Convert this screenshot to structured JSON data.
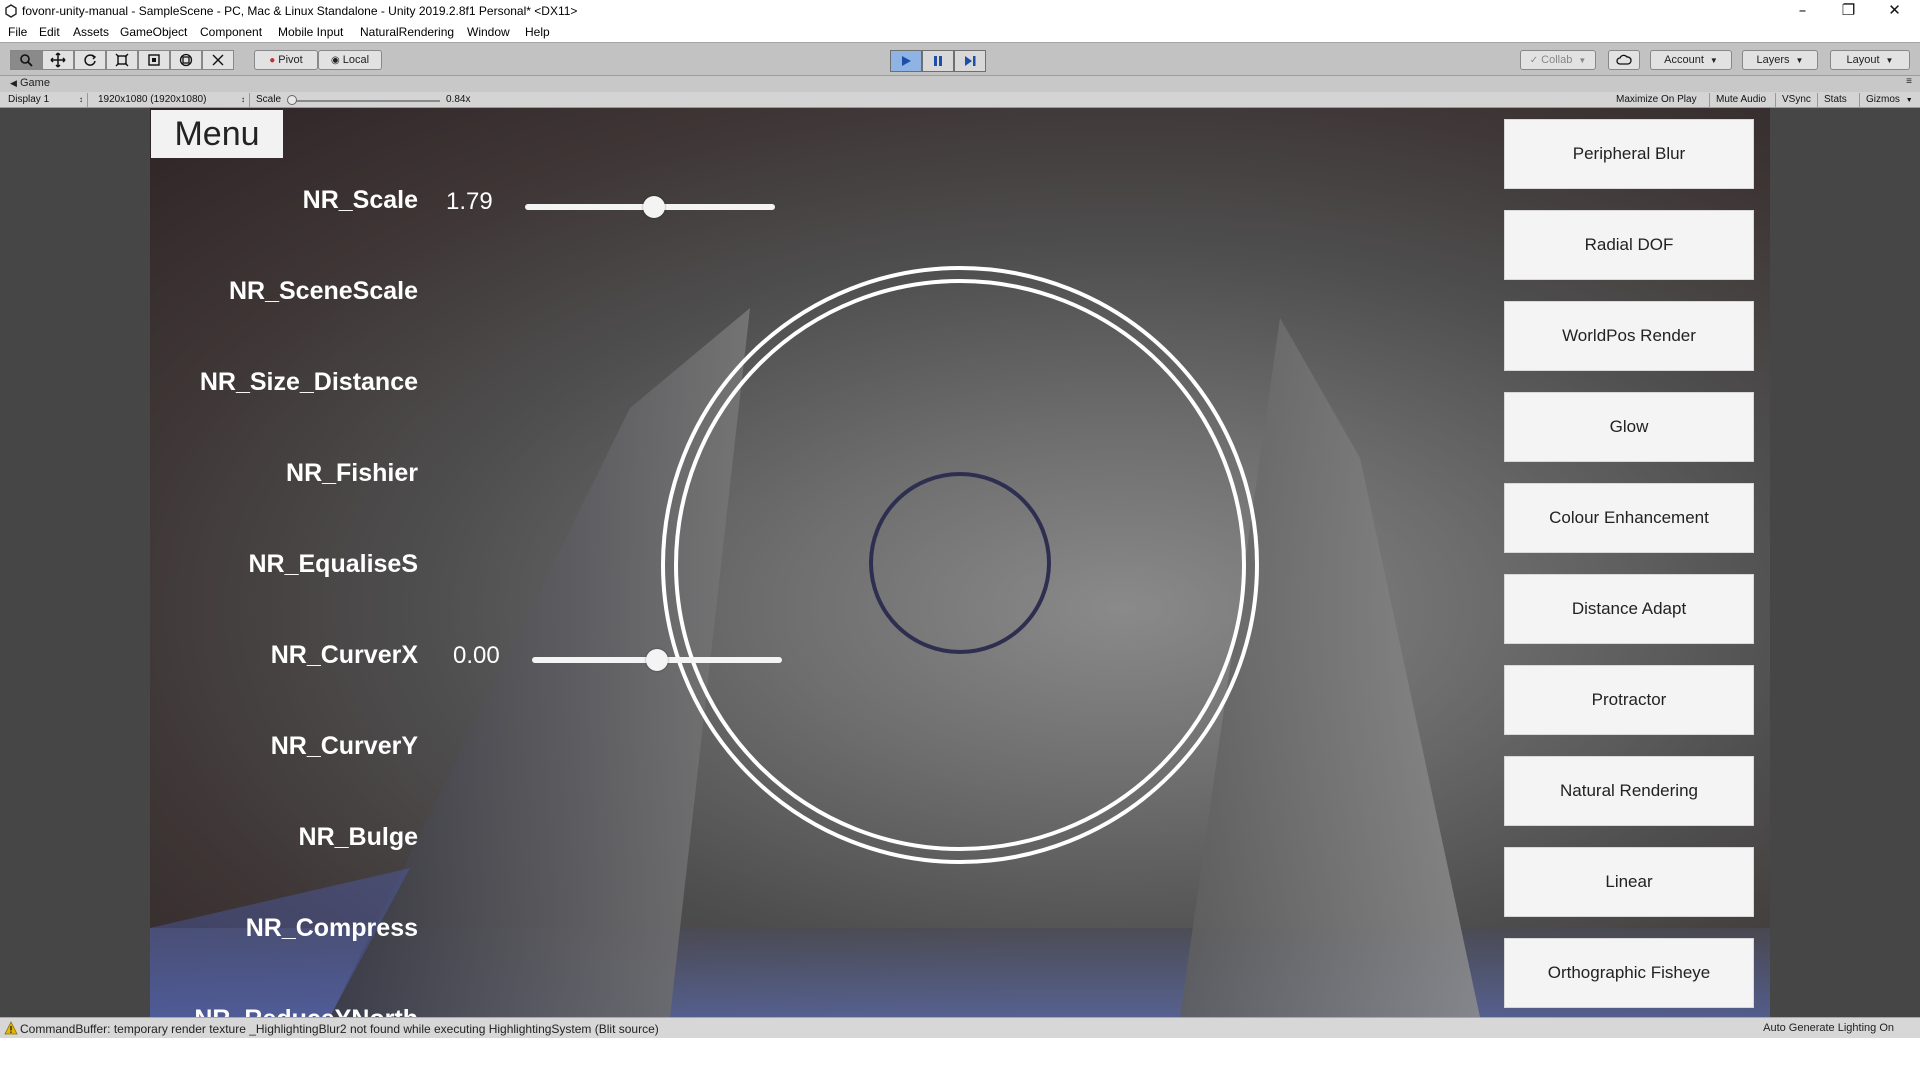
{
  "window": {
    "title": "fovonr-unity-manual - SampleScene - PC, Mac & Linux Standalone - Unity 2019.2.8f1 Personal* <DX11>",
    "minimize_icon": "minimize-icon",
    "restore_icon": "restore-icon",
    "close_icon": "close-icon"
  },
  "menubar": {
    "items": [
      "File",
      "Edit",
      "Assets",
      "GameObject",
      "Component",
      "Mobile Input",
      "NaturalRendering",
      "Window",
      "Help"
    ]
  },
  "toolbar": {
    "tools": [
      "hand-tool-icon",
      "move-tool-icon",
      "rotate-tool-icon",
      "scale-tool-icon",
      "rect-tool-icon",
      "transform-tool-icon",
      "custom-tool-icon"
    ],
    "pivot_label": "Pivot",
    "local_label": "Local",
    "collab_label": "Collab",
    "account_label": "Account",
    "layers_label": "Layers",
    "layout_label": "Layout",
    "play_state": "playing",
    "accent_color": "#8fb3e3"
  },
  "game_tab": {
    "label": "Game"
  },
  "game_controls": {
    "display": "Display 1",
    "resolution": "1920x1080 (1920x1080)",
    "scale_label": "Scale",
    "scale_value": "0.84x",
    "maximize": "Maximize On Play",
    "mute": "Mute Audio",
    "vsync": "VSync",
    "stats": "Stats",
    "gizmos": "Gizmos"
  },
  "game": {
    "menu_label": "Menu",
    "params": [
      {
        "label": "NR_Scale",
        "value": "1.79",
        "slider": 0.5
      },
      {
        "label": "NR_SceneScale"
      },
      {
        "label": "NR_Size_Distance"
      },
      {
        "label": "NR_Fishier"
      },
      {
        "label": "NR_EqualiseS"
      },
      {
        "label": "NR_CurverX",
        "value": "0.00",
        "slider": 0.5
      },
      {
        "label": "NR_CurverY"
      },
      {
        "label": "NR_Bulge"
      },
      {
        "label": "NR_Compress"
      },
      {
        "label": "NR_ReduceYNorth"
      }
    ],
    "effects": [
      "Peripheral Blur",
      "Radial DOF",
      "WorldPos Render",
      "Glow",
      "Colour Enhancement",
      "Distance Adapt",
      "Protractor",
      "Natural Rendering",
      "Linear",
      "Orthographic Fisheye"
    ]
  },
  "status": {
    "message": "CommandBuffer: temporary render texture _HighlightingBlur2 not found while executing HighlightingSystem (Blit source)",
    "lighting": "Auto Generate Lighting On",
    "warn_icon": "warning-icon",
    "warn_color": "#e6b800"
  }
}
